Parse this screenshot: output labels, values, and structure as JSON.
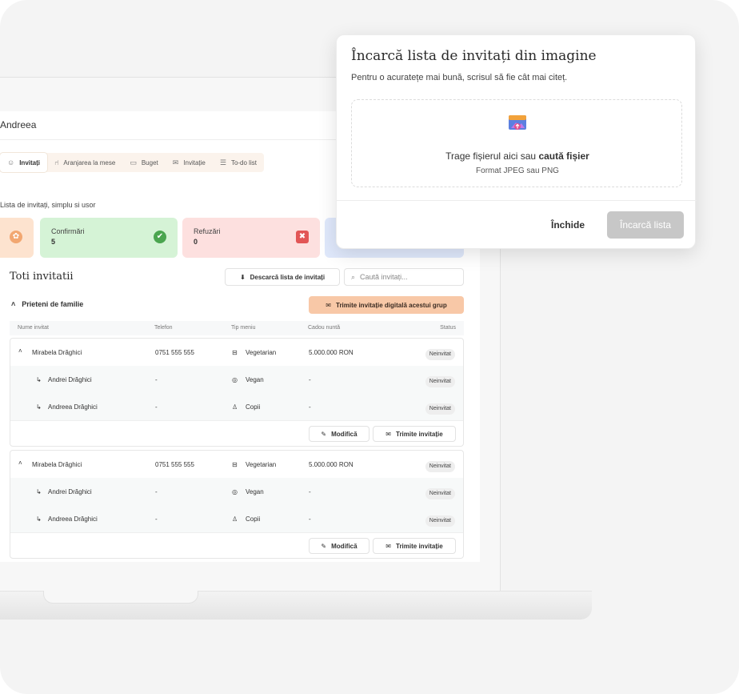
{
  "app": {
    "title": "Andreea",
    "tabs": [
      {
        "label": "Invitați",
        "icon": "people-icon"
      },
      {
        "label": "Aranjarea la mese",
        "icon": "chair-icon"
      },
      {
        "label": "Buget",
        "icon": "wallet-icon"
      },
      {
        "label": "Invitație",
        "icon": "envelope-icon"
      },
      {
        "label": "To-do list",
        "icon": "checklist-icon"
      }
    ],
    "subtitle": "Lista de invitați, simplu si usor",
    "stats": [
      {
        "label": "Confirmări",
        "value": "5",
        "color": "#d5f3d6"
      },
      {
        "label": "Refuzări",
        "value": "0",
        "color": "#fde0df"
      }
    ],
    "section_title": "Toti invitatii",
    "download_label": "Descarcă lista de invitați",
    "search_placeholder": "Caută invitați...",
    "group_name": "Prieteni de familie",
    "send_group_label": "Trimite invitație digitală acestui grup",
    "columns": [
      "Nume invitat",
      "Telefon",
      "Tip meniu",
      "Cadou nuntă",
      "Status"
    ],
    "cards": [
      {
        "rows": [
          {
            "name": "Mirabela Drăghici",
            "phone": "0751 555 555",
            "menu": "Vegetarian",
            "gift": "5.000.000 RON",
            "status": "Neinvitat"
          },
          {
            "name": "Andrei Drăghici",
            "phone": "-",
            "menu": "Vegan",
            "gift": "-",
            "status": "Neinvitat"
          },
          {
            "name": "Andreea Drăghici",
            "phone": "-",
            "menu": "Copii",
            "gift": "-",
            "status": "Neinvitat"
          }
        ],
        "edit_label": "Modifică",
        "send_label": "Trimite invitație"
      },
      {
        "rows": [
          {
            "name": "Mirabela Drăghici",
            "phone": "0751 555 555",
            "menu": "Vegetarian",
            "gift": "5.000.000 RON",
            "status": "Neinvitat"
          },
          {
            "name": "Andrei Drăghici",
            "phone": "-",
            "menu": "Vegan",
            "gift": "-",
            "status": "Neinvitat"
          },
          {
            "name": "Andreea Drăghici",
            "phone": "-",
            "menu": "Copii",
            "gift": "-",
            "status": "Neinvitat"
          }
        ],
        "edit_label": "Modifică",
        "send_label": "Trimite invitație"
      }
    ]
  },
  "modal": {
    "title": "Încarcă lista de invitați din imagine",
    "subtitle": "Pentru o acuratețe mai bună, scrisul să fie cât mai citeț.",
    "drop_text": "Trage fișierul aici sau",
    "drop_link": "caută fișier",
    "format_hint": "Format JPEG sau PNG",
    "close_label": "Închide",
    "upload_label": "Încarcă lista"
  },
  "colors": {
    "accent_orange": "#f8c8a7",
    "confirm_green": "#d5f3d6",
    "refuse_red": "#fde0df",
    "disabled_button": "#c7c7c7"
  }
}
